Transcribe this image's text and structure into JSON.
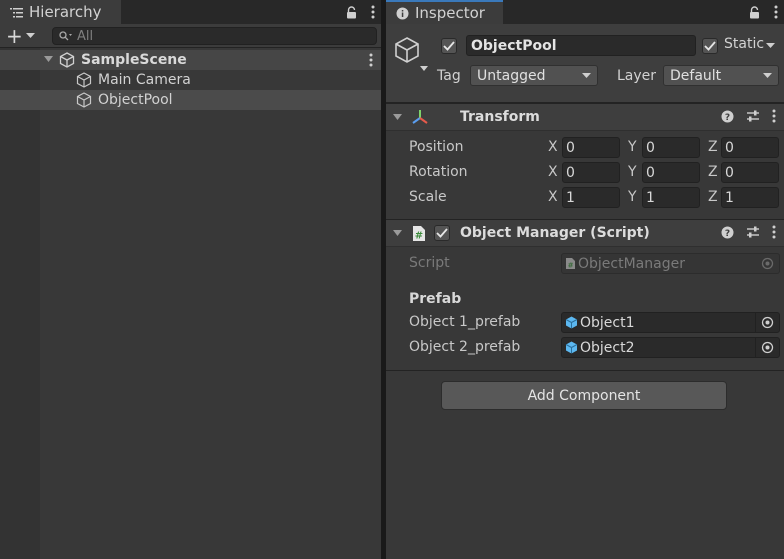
{
  "hierarchy": {
    "tab_label": "Hierarchy",
    "add_label": "+",
    "search_placeholder": "All",
    "scene_name": "SampleScene",
    "items": [
      {
        "label": "Main Camera"
      },
      {
        "label": "ObjectPool"
      }
    ]
  },
  "inspector": {
    "tab_label": "Inspector",
    "object_name": "ObjectPool",
    "static_label": "Static",
    "tag_label": "Tag",
    "tag_value": "Untagged",
    "layer_label": "Layer",
    "layer_value": "Default",
    "transform": {
      "title": "Transform",
      "axis_x": "X",
      "axis_y": "Y",
      "axis_z": "Z",
      "rows": [
        {
          "label": "Position",
          "x": "0",
          "y": "0",
          "z": "0"
        },
        {
          "label": "Rotation",
          "x": "0",
          "y": "0",
          "z": "0"
        },
        {
          "label": "Scale",
          "x": "1",
          "y": "1",
          "z": "1"
        }
      ]
    },
    "script_component": {
      "title": "Object Manager (Script)",
      "script_label": "Script",
      "script_value": "ObjectManager",
      "section_label": "Prefab",
      "fields": [
        {
          "label": "Object 1_prefab",
          "value": "Object1"
        },
        {
          "label": "Object 2_prefab",
          "value": "Object2"
        }
      ]
    },
    "add_component_label": "Add Component"
  },
  "colors": {
    "accent": "#3a79bb",
    "prefab_icon": "#5cb8f0",
    "background": "#383838"
  }
}
